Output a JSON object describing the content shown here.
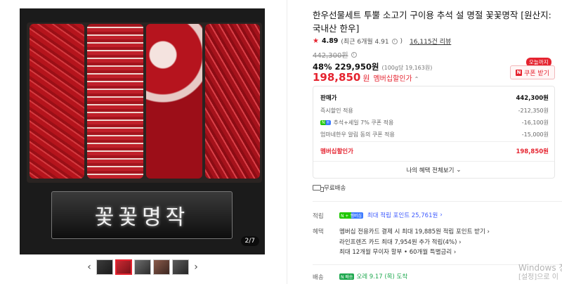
{
  "gallery": {
    "image_text": "꽃꽃명작",
    "pager": "2/7",
    "prev_arrow": "‹",
    "next_arrow": "›"
  },
  "product": {
    "title": "한우선물세트 투뿔 소고기 구이용 추석 설 명절 꽃꽃명작 [원산지: 국내산 한우]",
    "rating_score": "4.89",
    "rating_recent": "(최근 6개월 4.91",
    "rating_recent_close": ")",
    "review_count": "16,115건 리뷰",
    "original_price": "442,300원",
    "sale_rate": "48%",
    "sale_price": "229,950원",
    "unit_price": "(100g당 19,163원)",
    "member_price": "198,850",
    "member_won": "원",
    "member_label": "멤버십할인가",
    "today_badge": "오늘까지",
    "coupon_button": "쿠폰 받기"
  },
  "breakdown": {
    "rows": [
      {
        "label": "판매가",
        "value": "442,300원"
      },
      {
        "label": "즉시할인 적용",
        "value": "-212,350원"
      },
      {
        "label": "추석+세일 7% 쿠폰 적용",
        "value": "-16,100원"
      },
      {
        "label": "엄마네한우 알림 동의 쿠폰 적용",
        "value": "-15,000원"
      },
      {
        "label": "멤버십할인가",
        "value": "198,850원"
      }
    ],
    "np_badge": "N +",
    "benefit_link": "나의 혜택 전체보기",
    "benefit_caret": "⌄"
  },
  "shipping": {
    "free": "무료배송"
  },
  "points": {
    "label": "적립",
    "badge": "N + 멤버십",
    "text": "최대 적립 포인트 25,761원",
    "caret": "›"
  },
  "benefits": {
    "label": "혜택",
    "lines": [
      "멤버십 전용카드 결제 시 최대 19,885원 적립 포인트 받기  ›",
      "라인프렌즈 카드 최대 7,954원 추가 적립(4%)  ›",
      "최대 12개월 무이자 할부 • 60개월 특별금리  ›"
    ]
  },
  "delivery": {
    "label": "배송",
    "badge": "N 배송",
    "text": "오레 9.17 (목) 도착"
  },
  "watermark": {
    "line1": "Windows 정",
    "line2": "[설정]으로 이"
  }
}
